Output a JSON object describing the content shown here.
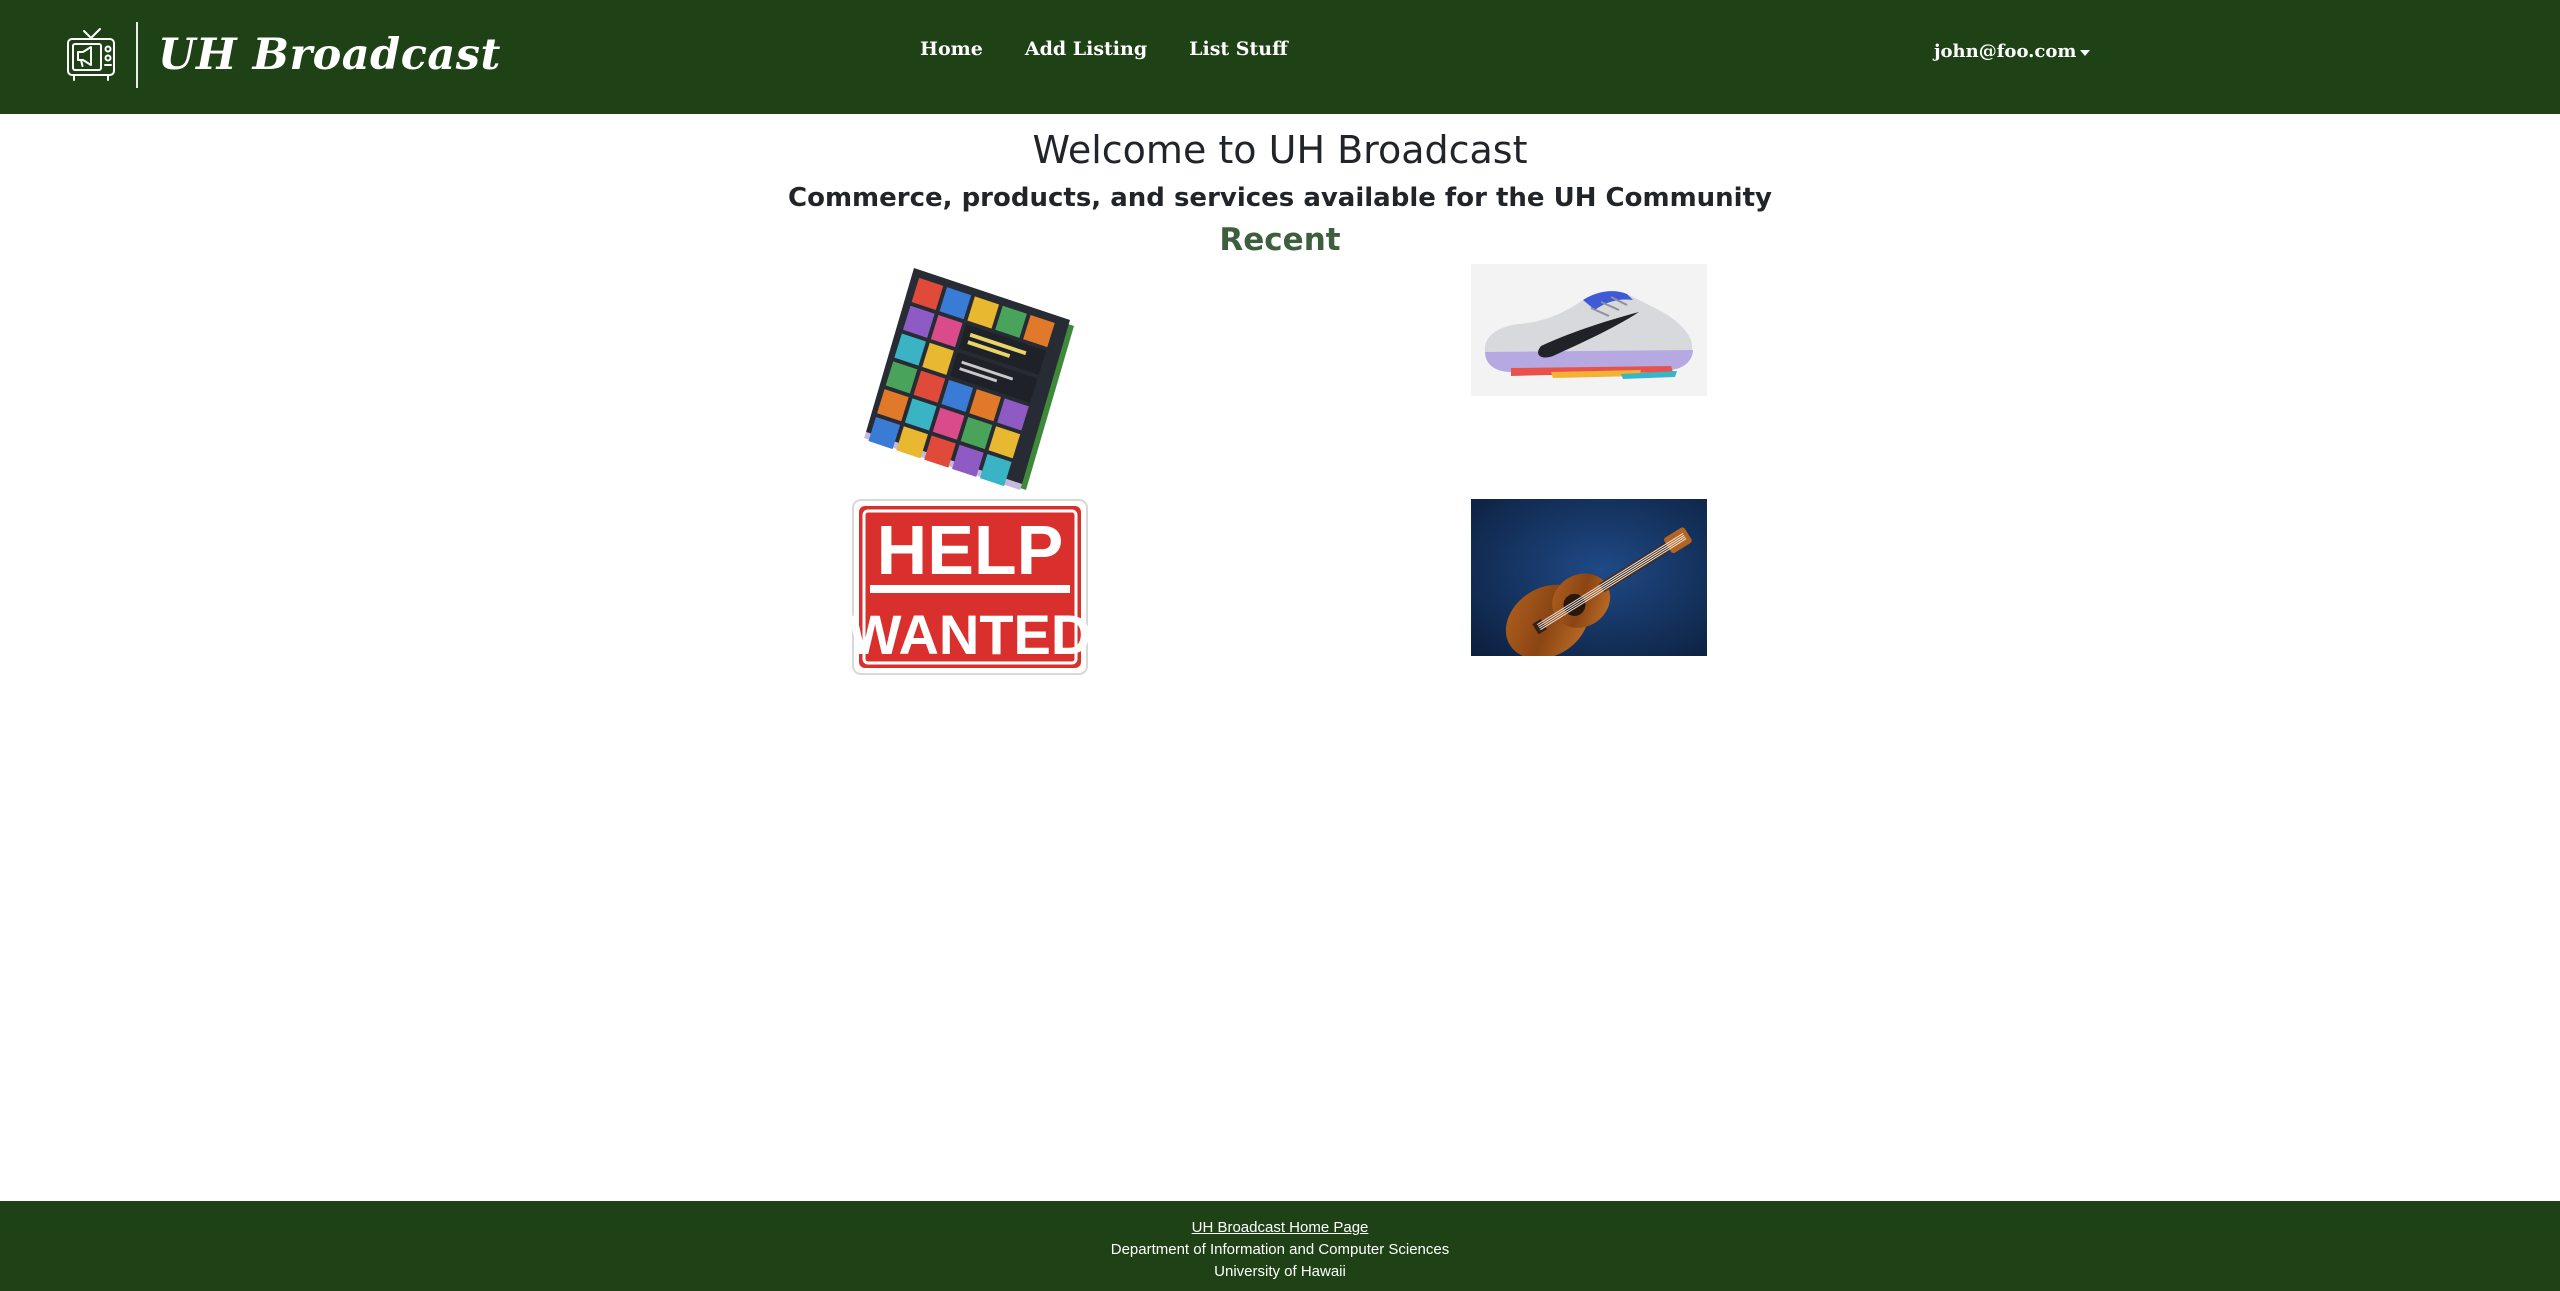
{
  "brand": {
    "name": "UH Broadcast",
    "logo_icon": "broadcast-tv-icon"
  },
  "nav": {
    "items": [
      {
        "label": "Home"
      },
      {
        "label": "Add Listing"
      },
      {
        "label": "List Stuff"
      }
    ]
  },
  "user": {
    "email": "john@foo.com",
    "menu_icon": "caret-down-icon"
  },
  "hero": {
    "title": "Welcome to UH Broadcast",
    "subtitle": "Commerce, products, and services available for the UH Community",
    "section": "Recent"
  },
  "recent_items": [
    {
      "image": "yiddish-workbook-book-cover"
    },
    {
      "image": "gray-athletic-sneaker"
    },
    {
      "image": "help-wanted-sign",
      "text_line1": "HELP",
      "text_line2": "WANTED"
    },
    {
      "image": "koa-ukulele-on-blue"
    }
  ],
  "footer": {
    "link": "UH Broadcast Home Page",
    "line1": "Department of Information and Computer Sciences",
    "line2": "University of Hawaii"
  },
  "colors": {
    "nav_bg": "#1e4216",
    "heading_green": "#3d5f3d",
    "sign_red": "#d9302d"
  }
}
